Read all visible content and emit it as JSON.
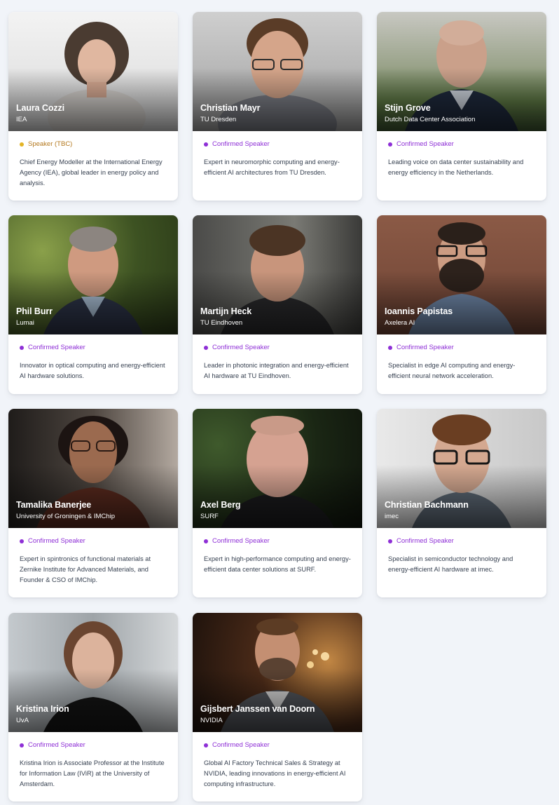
{
  "colors": {
    "confirmed": "#8e2fd6",
    "tbc_text": "#b4791f",
    "tbc_dot": "#e3b425"
  },
  "speakers": [
    {
      "name": "Laura Cozzi",
      "org": "IEA",
      "status": "Speaker (TBC)",
      "description": "Chief Energy Modeller at the International Energy Agency (IEA), global leader in energy policy and analysis."
    },
    {
      "name": "Christian Mayr",
      "org": "TU Dresden",
      "status": "Confirmed Speaker",
      "description": "Expert in neuromorphic computing and energy-efficient AI architectures from TU Dresden."
    },
    {
      "name": "Stijn Grove",
      "org": "Dutch Data Center Association",
      "status": "Confirmed Speaker",
      "description": "Leading voice on data center sustainability and energy efficiency in the Netherlands."
    },
    {
      "name": "Phil Burr",
      "org": "Lumai",
      "status": "Confirmed Speaker",
      "description": "Innovator in optical computing and energy-efficient AI hardware solutions."
    },
    {
      "name": "Martijn Heck",
      "org": "TU Eindhoven",
      "status": "Confirmed Speaker",
      "description": "Leader in photonic integration and energy-efficient AI hardware at TU Eindhoven."
    },
    {
      "name": "Ioannis Papistas",
      "org": "Axelera AI",
      "status": "Confirmed Speaker",
      "description": "Specialist in edge AI computing and energy-efficient neural network acceleration."
    },
    {
      "name": "Tamalika Banerjee",
      "org": "University of Groningen & IMChip",
      "status": "Confirmed Speaker",
      "description": "Expert in spintronics of functional materials at Zernike Institute for Advanced Materials, and Founder & CSO of IMChip."
    },
    {
      "name": "Axel Berg",
      "org": "SURF",
      "status": "Confirmed Speaker",
      "description": "Expert in high-performance computing and energy-efficient data center solutions at SURF."
    },
    {
      "name": "Christian Bachmann",
      "org": "imec",
      "status": "Confirmed Speaker",
      "description": "Specialist in semiconductor technology and energy-efficient AI hardware at imec."
    },
    {
      "name": "Kristina Irion",
      "org": "UvA",
      "status": "Confirmed Speaker",
      "description": "Kristina Irion is Associate Professor at the Institute for Information Law (IViR) at the University of Amsterdam."
    },
    {
      "name": "Gijsbert Janssen van Doorn",
      "org": "NVIDIA",
      "status": "Confirmed Speaker",
      "description": "Global AI Factory Technical Sales & Strategy at NVIDIA, leading innovations in energy-efficient AI computing infrastructure."
    }
  ]
}
